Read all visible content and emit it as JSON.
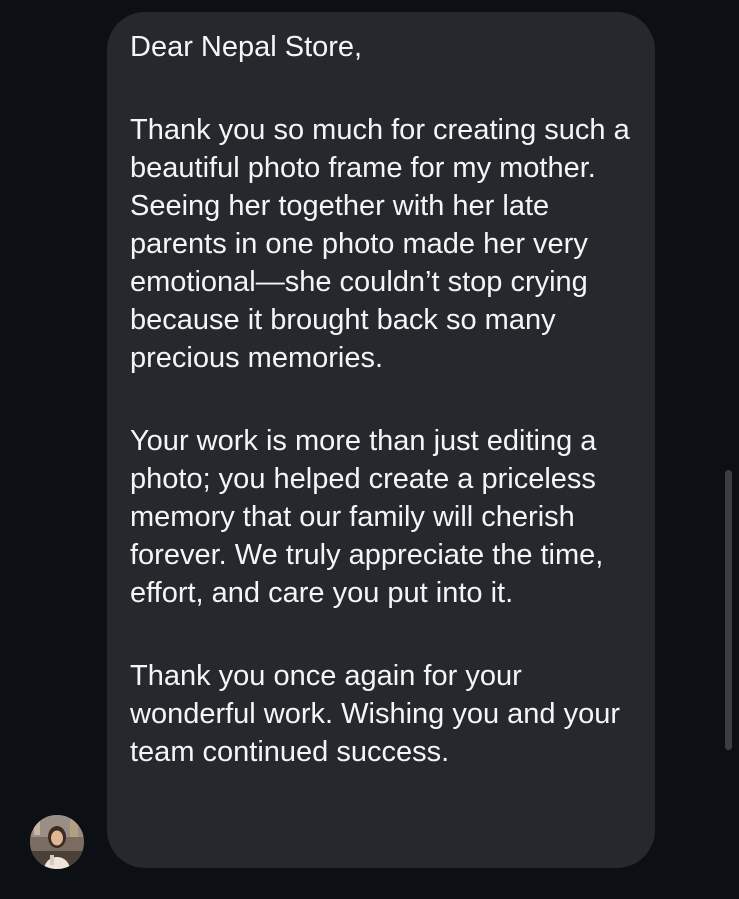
{
  "conversation": {
    "message": {
      "paragraphs": [
        "Dear Nepal Store,",
        "Thank you so much for creating such a beautiful photo frame for my mother. Seeing her together with her late parents in one photo made her very emotional—she couldn’t stop crying because it brought back so many precious memories.",
        "Your work is more than just editing a photo; you helped create a priceless memory that our family will cherish forever. We truly appreciate the time, effort, and care you put into it.",
        "Thank you once again for your wonderful work. Wishing you and your team continued success."
      ]
    },
    "sender_avatar_icon": "profile-photo-avatar"
  },
  "colors": {
    "background": "#0c1014",
    "bubble": "#25292e",
    "text": "#f5f5f5"
  }
}
